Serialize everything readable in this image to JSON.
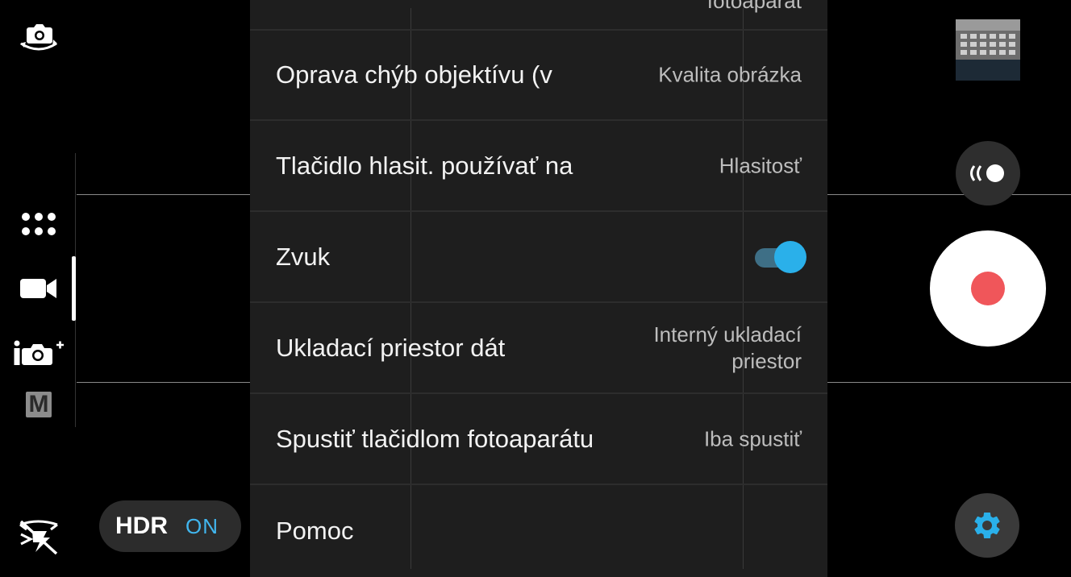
{
  "settings": {
    "top_partial_value": "fotoaparát",
    "rows": [
      {
        "label": "Oprava chýb objektívu (v",
        "value": "Kvalita obrázka"
      },
      {
        "label": "Tlačidlo hlasit. používať na",
        "value": "Hlasitosť"
      },
      {
        "label": "Zvuk",
        "toggle_on": true
      },
      {
        "label": "Ukladací priestor dát",
        "value_line1": "Interný ukladací",
        "value_line2": "priestor"
      },
      {
        "label": "Spustiť tlačidlom fotoaparátu",
        "value": "Iba spustiť"
      },
      {
        "label": "Pomoc"
      }
    ]
  },
  "hdr": {
    "label": "HDR",
    "state": "ON"
  },
  "left_rail": {
    "icons": [
      "camera-switch-icon",
      "more-modes-icon",
      "video-mode-icon",
      "intelligent-photo-icon",
      "manual-mode-icon",
      "flash-off-icon"
    ],
    "manual_letter": "M"
  },
  "right_rail": {
    "icons": [
      "gallery-thumbnail",
      "photo-video-toggle-icon",
      "record-button",
      "settings-gear-icon"
    ]
  },
  "colors": {
    "accent": "#2ab0ea",
    "record": "#f0565a",
    "panel": "#1e1e1e"
  }
}
